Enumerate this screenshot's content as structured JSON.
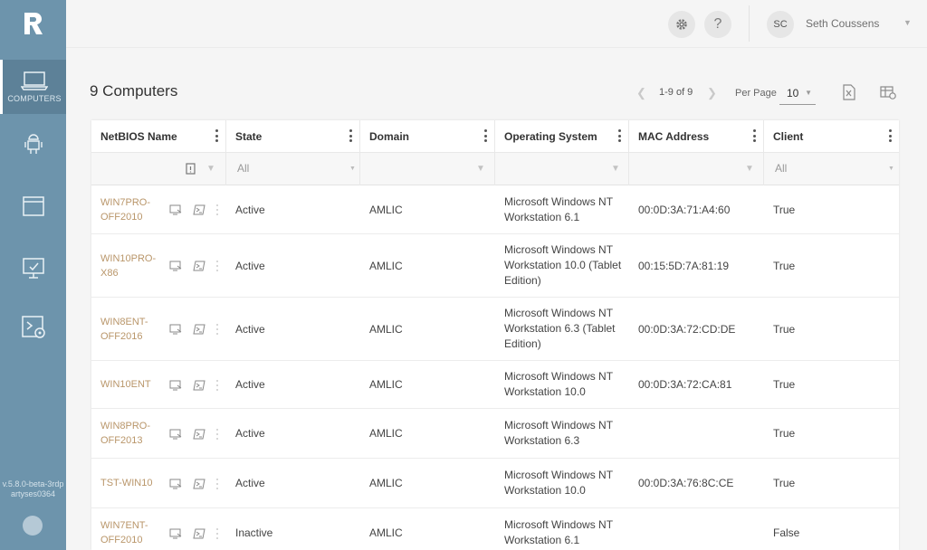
{
  "sidebar": {
    "nav": [
      {
        "label": "COMPUTERS",
        "icon": "laptop-icon",
        "active": true
      },
      {
        "label": "",
        "icon": "android-user-icon",
        "active": false
      },
      {
        "label": "",
        "icon": "window-icon",
        "active": false
      },
      {
        "label": "",
        "icon": "monitor-check-icon",
        "active": false
      },
      {
        "label": "",
        "icon": "powershell-gear-icon",
        "active": false
      }
    ],
    "version": "v.5.8.0-beta-3rdpartyses0364"
  },
  "topbar": {
    "settings_icon": "gear-icon",
    "help_label": "?",
    "user_initials": "SC",
    "user_name": "Seth Coussens"
  },
  "header": {
    "title": "9 Computers",
    "pager_range": "1-9 of 9",
    "per_page_label": "Per Page",
    "per_page_value": "10"
  },
  "table": {
    "columns": [
      "NetBIOS Name",
      "State",
      "Domain",
      "Operating System",
      "MAC Address",
      "Client"
    ],
    "filters": {
      "state": "All",
      "client": "All"
    },
    "rows": [
      {
        "name": "WIN7PRO-OFF2010",
        "state": "Active",
        "domain": "AMLIC",
        "os": "Microsoft Windows NT Workstation 6.1",
        "mac": "00:0D:3A:71:A4:60",
        "client": "True"
      },
      {
        "name": "WIN10PRO-X86",
        "state": "Active",
        "domain": "AMLIC",
        "os": "Microsoft Windows NT Workstation 10.0 (Tablet Edition)",
        "mac": "00:15:5D:7A:81:19",
        "client": "True"
      },
      {
        "name": "WIN8ENT-OFF2016",
        "state": "Active",
        "domain": "AMLIC",
        "os": "Microsoft Windows NT Workstation 6.3 (Tablet Edition)",
        "mac": "00:0D:3A:72:CD:DE",
        "client": "True"
      },
      {
        "name": "WIN10ENT",
        "state": "Active",
        "domain": "AMLIC",
        "os": "Microsoft Windows NT Workstation 10.0",
        "mac": "00:0D:3A:72:CA:81",
        "client": "True"
      },
      {
        "name": "WIN8PRO-OFF2013",
        "state": "Active",
        "domain": "AMLIC",
        "os": "Microsoft Windows NT Workstation 6.3",
        "mac": "",
        "client": "True"
      },
      {
        "name": "TST-WIN10",
        "state": "Active",
        "domain": "AMLIC",
        "os": "Microsoft Windows NT Workstation 10.0",
        "mac": "00:0D:3A:76:8C:CE",
        "client": "True"
      },
      {
        "name": "WIN7ENT-OFF2010",
        "state": "Inactive",
        "domain": "AMLIC",
        "os": "Microsoft Windows NT Workstation 6.1",
        "mac": "",
        "client": "False"
      }
    ]
  },
  "colors": {
    "sidebar": "#6d94ac",
    "link": "#b9966a"
  }
}
